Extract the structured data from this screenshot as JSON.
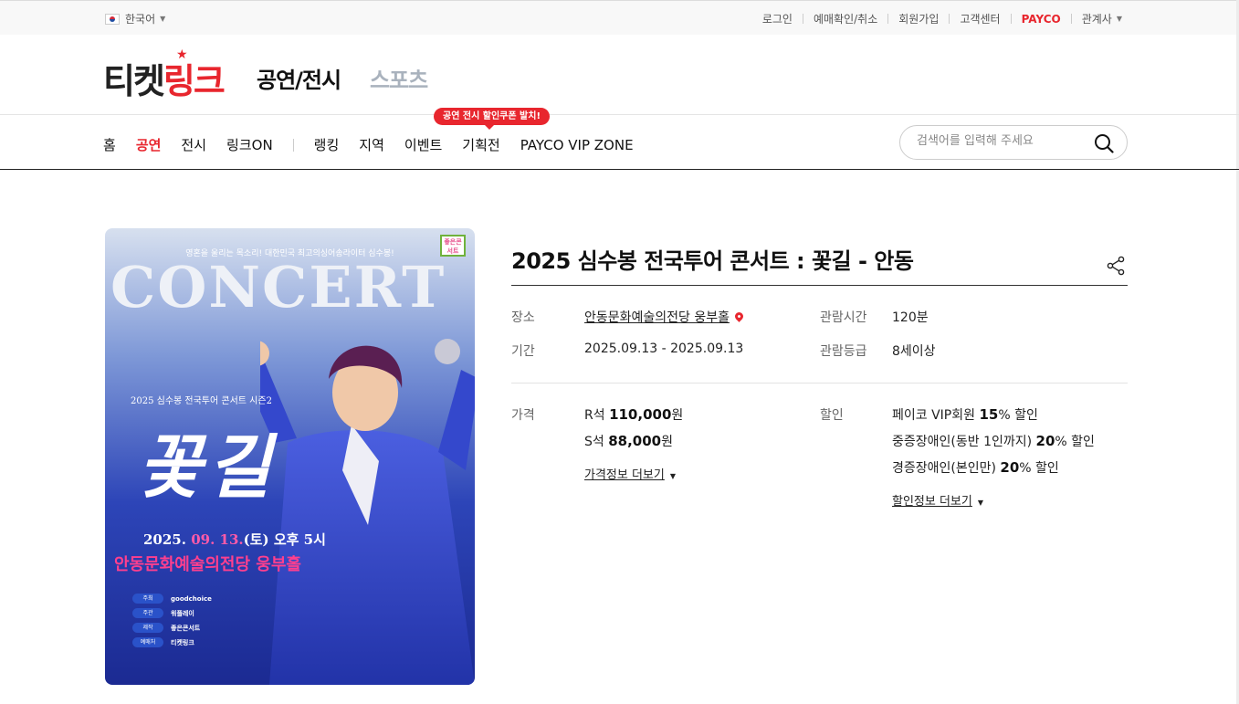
{
  "topbar": {
    "language": "한국어",
    "links": [
      "로그인",
      "예매확인/취소",
      "회원가입",
      "고객센터",
      "PAYCO",
      "관계사"
    ]
  },
  "header": {
    "logo_dark": "티켓",
    "logo_red": "링크",
    "tab_performance": "공연/전시",
    "tab_sports": "스포츠"
  },
  "gnb": {
    "items": [
      "홈",
      "공연",
      "전시",
      "링크ON",
      "랭킹",
      "지역",
      "이벤트",
      "기획전",
      "PAYCO VIP ZONE"
    ],
    "active_index": 1,
    "promo_badge": "공연 전시 할인쿠폰 발치!"
  },
  "search": {
    "placeholder": "검색어를 입력해 주세요"
  },
  "poster": {
    "tagline": "영혼을 울리는 목소리! 대한민국 최고의싱어송라이터 심수봉!",
    "badge": "좋은콘서트",
    "headline": "CONCERT",
    "subtitle": "2025 심수봉 전국투어 콘서트 시즌2",
    "script_title": "꽃길",
    "date_prefix": "2025. ",
    "date_highlight": "09. 13.",
    "date_suffix": "(토) 오후 5시",
    "venue": "안동문화예술의전당 웅부홀",
    "credits": [
      {
        "key": "주최",
        "value": "goodchoice"
      },
      {
        "key": "주관",
        "value": "워플레이"
      },
      {
        "key": "제작",
        "value": "좋은콘서트"
      },
      {
        "key": "예매처",
        "value": "티켓링크"
      }
    ]
  },
  "detail": {
    "title": "2025 심수봉 전국투어 콘서트 : 꽃길 - 안동",
    "venue_label": "장소",
    "venue_value": "안동문화예술의전당 웅부홀",
    "runtime_label": "관람시간",
    "runtime_value": "120분",
    "period_label": "기간",
    "period_value": "2025.09.13 - 2025.09.13",
    "rating_label": "관람등급",
    "rating_value": "8세이상",
    "price_label": "가격",
    "prices": [
      {
        "seat": "R석",
        "amount": "110,000",
        "unit": "원"
      },
      {
        "seat": "S석",
        "amount": "88,000",
        "unit": "원"
      }
    ],
    "price_more": "가격정보 더보기",
    "discount_label": "할인",
    "discounts": [
      {
        "name": "페이코 VIP회원",
        "rate": "15",
        "suffix": "% 할인"
      },
      {
        "name": "중증장애인(동반 1인까지)",
        "rate": "20",
        "suffix": "% 할인"
      },
      {
        "name": "경증장애인(본인만)",
        "rate": "20",
        "suffix": "% 할인"
      }
    ],
    "discount_more": "할인정보 더보기"
  },
  "colors": {
    "brand_red": "#e8262e",
    "sports_gray": "#a9b2bd",
    "poster_blue": "#2d45b8"
  }
}
